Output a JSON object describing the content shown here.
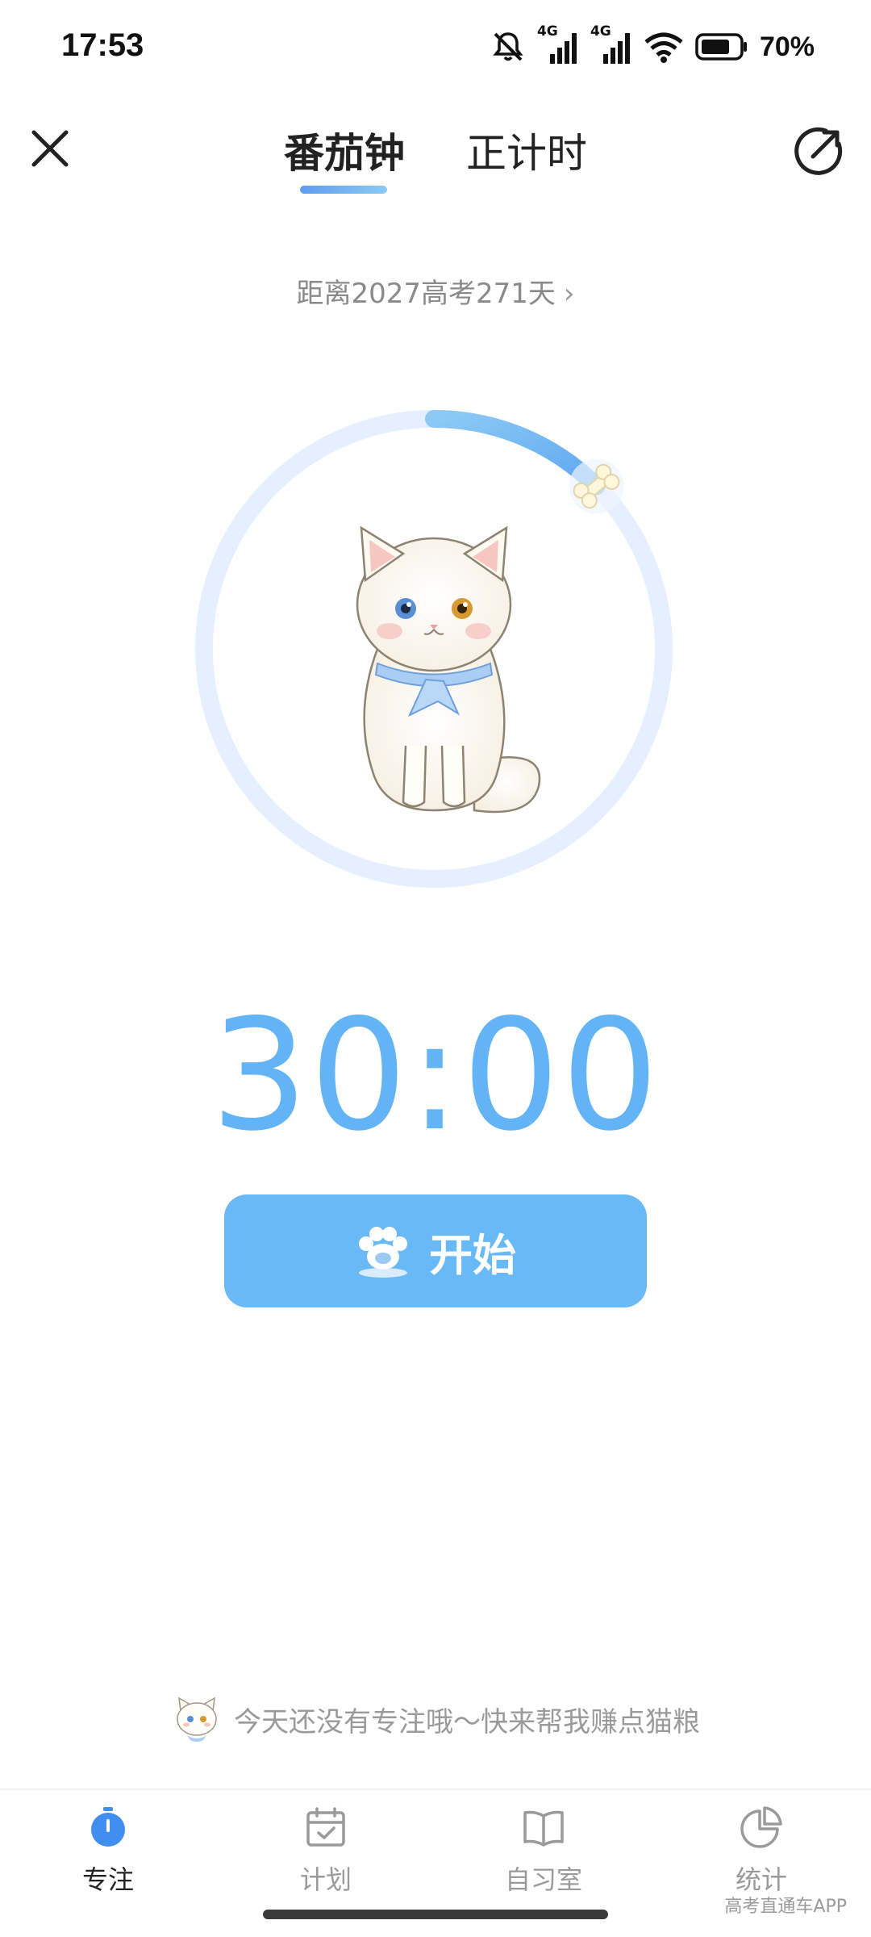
{
  "status_bar": {
    "time": "17:53",
    "network_1": "4G",
    "network_2": "4G",
    "battery": "70%"
  },
  "header": {
    "tabs": [
      {
        "label": "番茄钟",
        "active": true
      },
      {
        "label": "正计时",
        "active": false
      }
    ],
    "close_icon": "close-icon",
    "share_icon": "share-icon"
  },
  "countdown": {
    "text": "距离2027高考271天",
    "chevron": "›"
  },
  "ring": {
    "progress": 0.125,
    "track_color": "#e6efff",
    "progress_color": "#6ab3f4"
  },
  "timer": {
    "value": "30:00"
  },
  "start_button": {
    "label": "开始",
    "icon": "paw-icon"
  },
  "tip": {
    "text": "今天还没有专注哦～快来帮我赚点猫粮"
  },
  "bottom_nav": {
    "items": [
      {
        "label": "专注",
        "icon": "stopwatch-icon",
        "active": true
      },
      {
        "label": "计划",
        "icon": "calendar-check-icon",
        "active": false
      },
      {
        "label": "自习室",
        "icon": "book-icon",
        "active": false
      },
      {
        "label": "统计",
        "icon": "pie-chart-icon",
        "active": false
      }
    ]
  },
  "watermark": "高考直通车APP",
  "colors": {
    "accent": "#6ab9f7",
    "timer": "#63b4f7",
    "active_nav": "#3f8ef0"
  }
}
